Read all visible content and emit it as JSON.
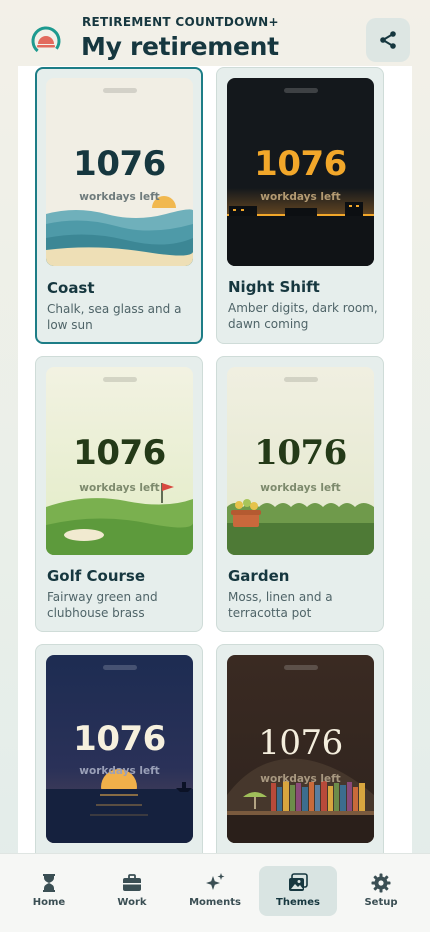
{
  "header": {
    "kicker": "RETIREMENT COUNTDOWN+",
    "title": "My retirement",
    "share_icon": "share-icon",
    "logo_icon": "sunrise-logo-icon"
  },
  "themes": [
    {
      "id": "coast",
      "title": "Coast",
      "description": "Chalk, sea glass and a low sun",
      "count": "1076",
      "sub": "workdays left",
      "selected": true
    },
    {
      "id": "night-shift",
      "title": "Night Shift",
      "description": "Amber digits, dark room, dawn coming",
      "count": "1076",
      "sub": "workdays left",
      "selected": false
    },
    {
      "id": "golf-course",
      "title": "Golf Course",
      "description": "Fairway green and clubhouse brass",
      "count": "1076",
      "sub": "workdays left",
      "selected": false
    },
    {
      "id": "garden",
      "title": "Garden",
      "description": "Moss, linen and a terracotta pot",
      "count": "1076",
      "sub": "workdays left",
      "selected": false
    },
    {
      "id": "harbor-dusk",
      "title": "",
      "description": "",
      "count": "1076",
      "sub": "workdays left",
      "selected": false
    },
    {
      "id": "library",
      "title": "",
      "description": "",
      "count": "1076",
      "sub": "workdays left",
      "selected": false
    }
  ],
  "nav": [
    {
      "label": "Home",
      "icon": "hourglass-icon",
      "active": false
    },
    {
      "label": "Work",
      "icon": "briefcase-icon",
      "active": false
    },
    {
      "label": "Moments",
      "icon": "sparkles-icon",
      "active": false
    },
    {
      "label": "Themes",
      "icon": "photo-gallery-icon",
      "active": true
    },
    {
      "label": "Setup",
      "icon": "gear-icon",
      "active": false
    }
  ],
  "colors": {
    "accent": "#1d7d86",
    "ink": "#16373f",
    "amber": "#f2a72a"
  }
}
